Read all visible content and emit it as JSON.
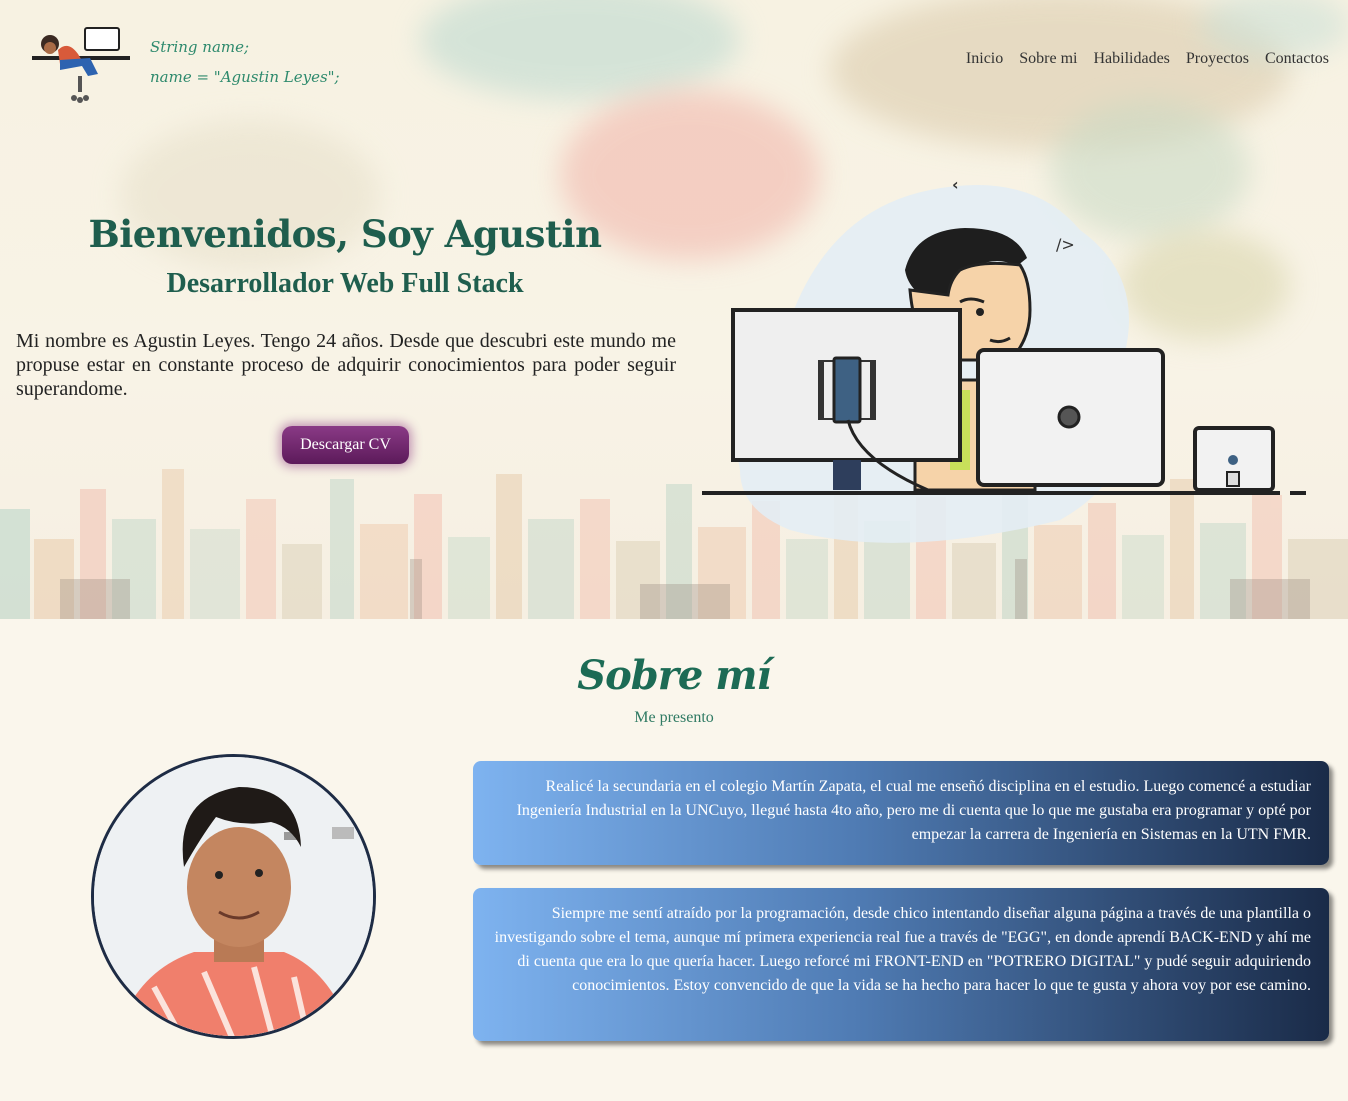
{
  "header": {
    "logo_icon": "developer-desk-logo",
    "code_line1": "String name;",
    "code_line2": "name = \"Agustin Leyes\";"
  },
  "nav": {
    "items": [
      {
        "label": "Inicio"
      },
      {
        "label": "Sobre mi"
      },
      {
        "label": "Habilidades"
      },
      {
        "label": "Proyectos"
      },
      {
        "label": "Contactos"
      }
    ]
  },
  "hero": {
    "title": "Bienvenidos, Soy Agustin",
    "subtitle": "Desarrollador Web Full Stack",
    "description": "Mi nombre es Agustin Leyes. Tengo 24 años. Desde que descubri este mundo me propuse estar en constante proceso de adquirir conocimientos para poder seguir superandome.",
    "cv_button": "Descargar CV",
    "illustration_icon": "developer-at-computer-illustration",
    "code_symbol_left": "‹",
    "code_symbol_right": "/>"
  },
  "about": {
    "title": "Sobre mí",
    "subtitle": "Me presento",
    "avatar_icon": "profile-photo",
    "paragraph1": "Realicé la secundaria en el colegio Martín Zapata, el cual me enseñó disciplina en el estudio. Luego comencé a estudiar Ingeniería Industrial en la UNCuyo, llegué hasta 4to año, pero me di cuenta que lo que me gustaba era programar y opté por empezar la carrera de Ingeniería en Sistemas en la UTN FMR.",
    "paragraph2": "Siempre me sentí atraído por la programación, desde chico intentando diseñar alguna página a través de una plantilla o investigando sobre el tema, aunque mí primera experiencia real fue a través de \"EGG\", en donde aprendí BACK-END y ahí me di cuenta que era lo que quería hacer. Luego reforcé mi FRONT-END en \"POTRERO DIGITAL\" y pudé seguir adquiriendo conocimientos. Estoy convencido de que la vida se ha hecho para hacer lo que te gusta y ahora voy por ese camino."
  },
  "colors": {
    "accent_green": "#1f5e4e",
    "button_purple": "#6e2a6b",
    "card_dark": "#1a2b48",
    "card_light": "#7eb3f0",
    "background": "#faf6ec"
  }
}
